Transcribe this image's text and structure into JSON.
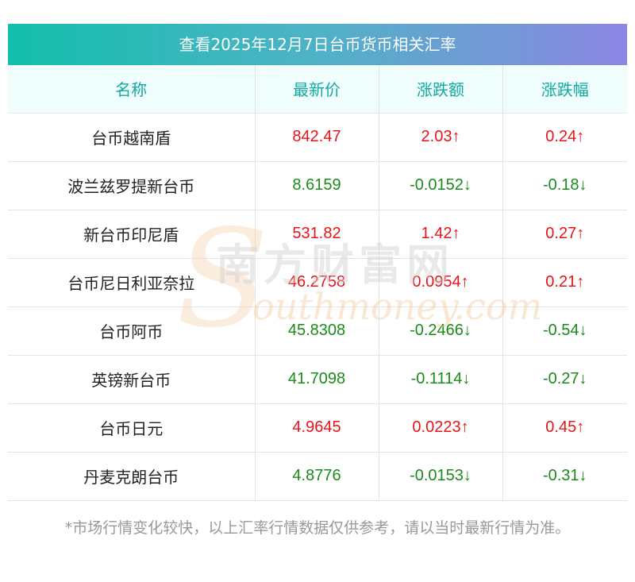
{
  "title": "查看2025年12月7日台币货币相关汇率",
  "columns": {
    "name": "名称",
    "price": "最新价",
    "change": "涨跌额",
    "pct": "涨跌幅"
  },
  "rows": [
    {
      "name": "台币越南盾",
      "price": "842.47",
      "change": "2.03↑",
      "pct": "0.24↑",
      "direction": "up"
    },
    {
      "name": "波兰兹罗提新台币",
      "price": "8.6159",
      "change": "-0.0152↓",
      "pct": "-0.18↓",
      "direction": "down"
    },
    {
      "name": "新台币印尼盾",
      "price": "531.82",
      "change": "1.42↑",
      "pct": "0.27↑",
      "direction": "up"
    },
    {
      "name": "台币尼日利亚奈拉",
      "price": "46.2758",
      "change": "0.0954↑",
      "pct": "0.21↑",
      "direction": "up"
    },
    {
      "name": "台币阿币",
      "price": "45.8308",
      "change": "-0.2466↓",
      "pct": "-0.54↓",
      "direction": "down"
    },
    {
      "name": "英镑新台币",
      "price": "41.7098",
      "change": "-0.1114↓",
      "pct": "-0.27↓",
      "direction": "down"
    },
    {
      "name": "台币日元",
      "price": "4.9645",
      "change": "0.0223↑",
      "pct": "0.45↑",
      "direction": "up"
    },
    {
      "name": "丹麦克朗台币",
      "price": "4.8776",
      "change": "-0.0153↓",
      "pct": "-0.31↓",
      "direction": "down"
    }
  ],
  "footnote": "*市场行情变化较快，以上汇率行情数据仅供参考，请以当时最新行情为准。",
  "watermark": {
    "cn": "南方财富网",
    "en": "outhmoney.com",
    "letter": "S"
  },
  "colors": {
    "up": "#e8141a",
    "down": "#1a8c1a",
    "header_text": "#12a9a0",
    "title_gradient_start": "#13bfac",
    "title_gradient_end": "#8d85e3"
  }
}
